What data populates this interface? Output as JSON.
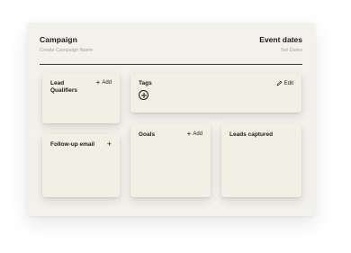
{
  "header": {
    "title": "Campaign",
    "subtitle": "Create Campaign Name",
    "dates_title": "Event dates",
    "dates_subtitle": "Set Dates"
  },
  "cards": {
    "lead_qualifiers": {
      "title_line1": "Lead",
      "title_line2": "Qualifiers",
      "action": "Add"
    },
    "tags": {
      "title": "Tags",
      "action": "Edit"
    },
    "followup": {
      "title": "Follow-up email"
    },
    "goals": {
      "title": "Goals",
      "action": "Add"
    },
    "leads": {
      "title": "Leads captured"
    }
  },
  "icons": {
    "plus": "+"
  }
}
